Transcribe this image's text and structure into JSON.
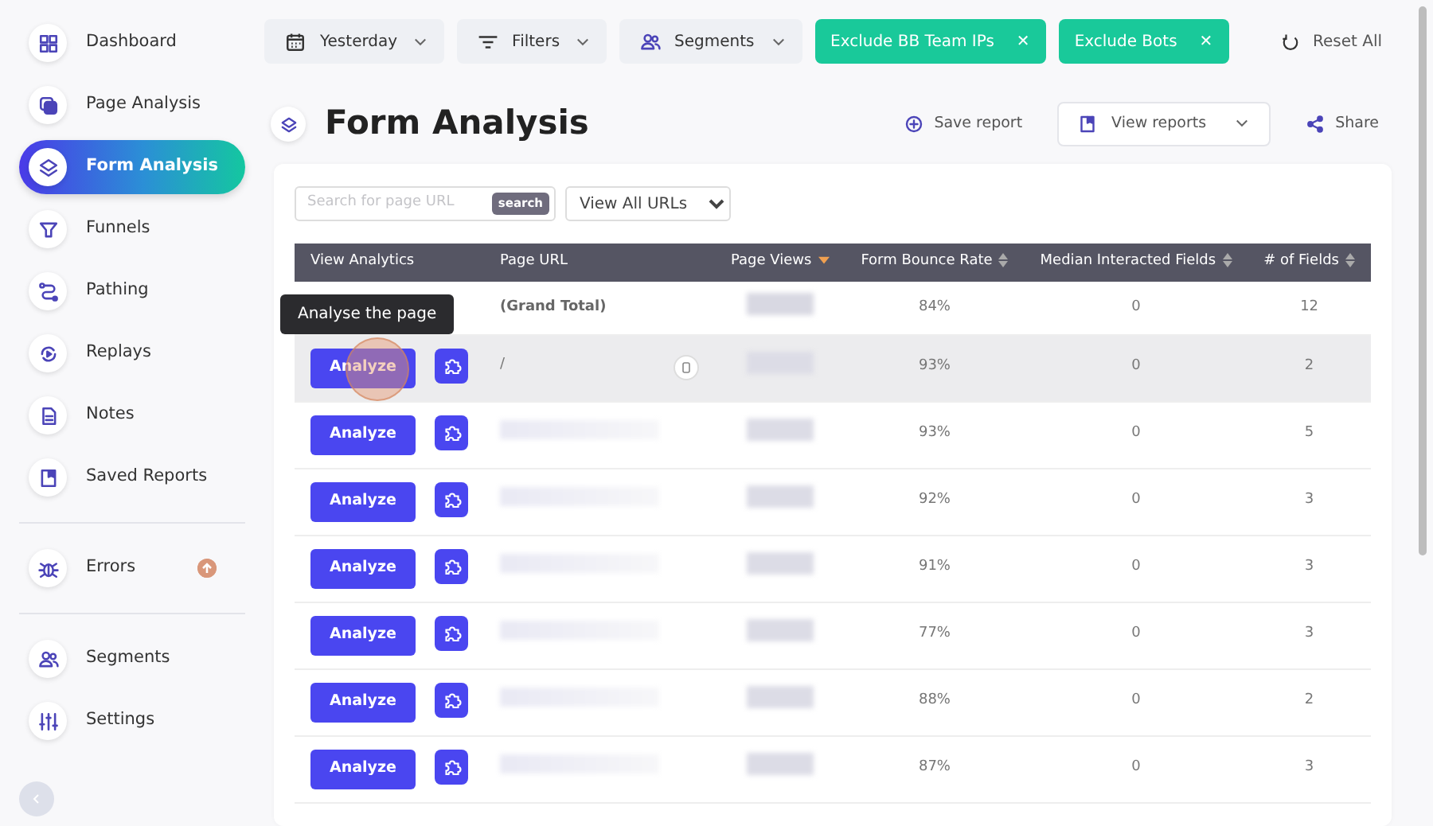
{
  "sidebar": {
    "items": [
      {
        "kind": "nav",
        "label": "Dashboard",
        "selected": false
      },
      {
        "kind": "nav",
        "label": "Page Analysis",
        "selected": false
      },
      {
        "kind": "nav",
        "label": "Form Analysis",
        "selected": true
      },
      {
        "kind": "nav",
        "label": "Funnels",
        "selected": false
      },
      {
        "kind": "nav",
        "label": "Pathing",
        "selected": false
      },
      {
        "kind": "nav",
        "label": "Replays",
        "selected": false
      },
      {
        "kind": "nav",
        "label": "Notes",
        "selected": false
      },
      {
        "kind": "nav",
        "label": "Saved Reports",
        "selected": false
      },
      {
        "kind": "divider"
      },
      {
        "kind": "nav",
        "label": "Errors",
        "selected": false
      },
      {
        "kind": "divider"
      },
      {
        "kind": "nav",
        "label": "Segments",
        "selected": false
      },
      {
        "kind": "nav",
        "label": "Settings",
        "selected": false
      }
    ]
  },
  "filters": [
    {
      "kind": "dropdown",
      "label": "Yesterday"
    },
    {
      "kind": "dropdown",
      "label": "Filters"
    },
    {
      "kind": "dropdown",
      "label": "Segments"
    },
    {
      "kind": "chip",
      "label": "Exclude BB Team IPs",
      "close": "✕"
    },
    {
      "kind": "chip",
      "label": "Exclude Bots",
      "close": "✕"
    }
  ],
  "reset": {
    "label": "Reset All"
  },
  "page_title": "Form Analysis",
  "actions": [
    {
      "kind": "link",
      "label": "Save report"
    },
    {
      "kind": "dropdown",
      "label": "View reports"
    },
    {
      "kind": "link",
      "label": "Share"
    }
  ],
  "search": {
    "placeholder": "Search for page URL",
    "button": "search"
  },
  "url_filter": {
    "value": "View All URLs"
  },
  "table": {
    "columns": [
      {
        "label": "View Analytics",
        "sorted": false
      },
      {
        "label": "Page URL",
        "sorted": false
      },
      {
        "label": "Page Views",
        "sorted": true
      },
      {
        "label": "Form Bounce Rate",
        "sorted": false
      },
      {
        "label": "Median Interacted Fields",
        "sorted": false
      },
      {
        "label": "# of Fields",
        "sorted": false
      }
    ],
    "total": {
      "url": "(Grand Total)",
      "bounce": "84%",
      "median": "0",
      "fields": "12"
    },
    "rows": [
      {
        "tooltip": "Analyse the page",
        "button": "Analyze",
        "url": "/",
        "bounce": "93%",
        "median": "0",
        "fields": "2",
        "selected": true
      },
      {
        "button": "Analyze",
        "bounce": "93%",
        "median": "0",
        "fields": "5",
        "selected": false
      },
      {
        "button": "Analyze",
        "bounce": "92%",
        "median": "0",
        "fields": "3",
        "selected": false
      },
      {
        "button": "Analyze",
        "bounce": "91%",
        "median": "0",
        "fields": "3",
        "selected": false
      },
      {
        "button": "Analyze",
        "bounce": "77%",
        "median": "0",
        "fields": "3",
        "selected": false
      },
      {
        "button": "Analyze",
        "bounce": "88%",
        "median": "0",
        "fields": "2",
        "selected": false
      },
      {
        "button": "Analyze",
        "bounce": "87%",
        "median": "0",
        "fields": "3",
        "selected": false
      }
    ]
  }
}
